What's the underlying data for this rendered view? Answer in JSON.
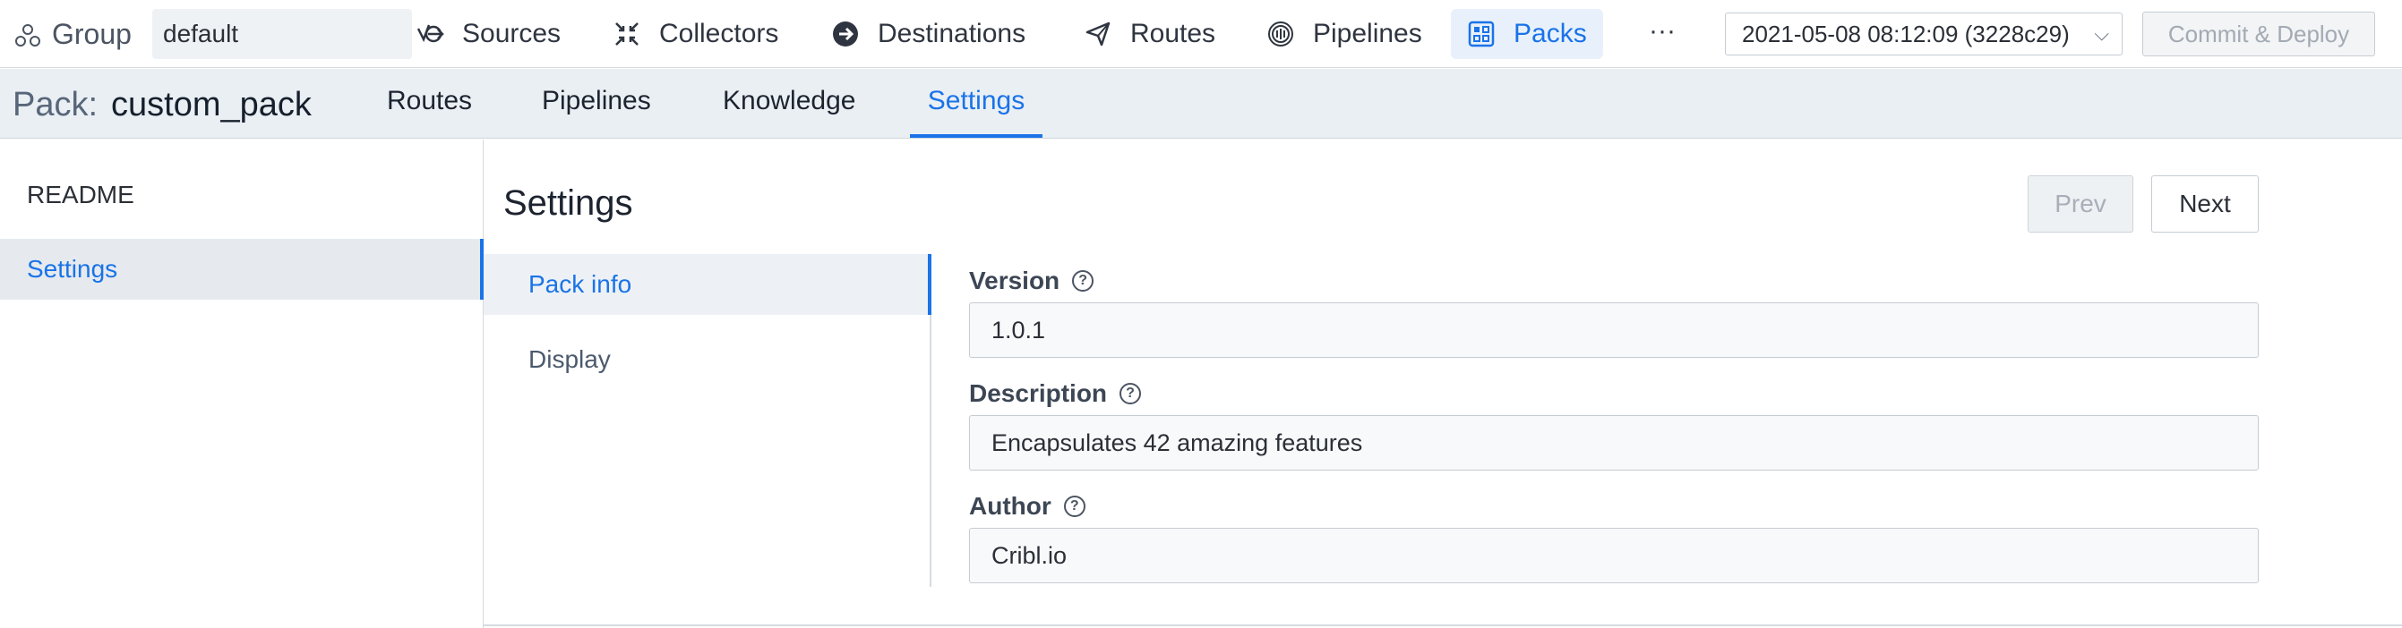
{
  "topnav": {
    "group_label": "Group",
    "group_value": "default",
    "items": [
      {
        "label": "Sources",
        "icon": "sources-icon"
      },
      {
        "label": "Collectors",
        "icon": "collectors-icon"
      },
      {
        "label": "Destinations",
        "icon": "destinations-icon"
      },
      {
        "label": "Routes",
        "icon": "routes-icon"
      },
      {
        "label": "Pipelines",
        "icon": "pipelines-icon"
      },
      {
        "label": "Packs",
        "icon": "packs-icon",
        "active": true
      }
    ],
    "more": "···",
    "version": "2021-05-08 08:12:09 (3228c29)",
    "commit_label": "Commit & Deploy"
  },
  "pack": {
    "prefix": "Pack:",
    "name": "custom_pack",
    "tabs": [
      "Routes",
      "Pipelines",
      "Knowledge",
      "Settings"
    ],
    "active_tab": "Settings"
  },
  "sidebar": {
    "items": [
      "README",
      "Settings"
    ],
    "active": "Settings"
  },
  "main": {
    "title": "Settings",
    "prev_label": "Prev",
    "next_label": "Next",
    "subnav": [
      "Pack info",
      "Display"
    ],
    "active_subnav": "Pack info",
    "fields": [
      {
        "label": "Version",
        "value": "1.0.1"
      },
      {
        "label": "Description",
        "value": "Encapsulates 42 amazing features"
      },
      {
        "label": "Author",
        "value": "Cribl.io"
      }
    ]
  },
  "colors": {
    "accent": "#1a73e8",
    "pack_header_bg": "#eaeff4"
  }
}
